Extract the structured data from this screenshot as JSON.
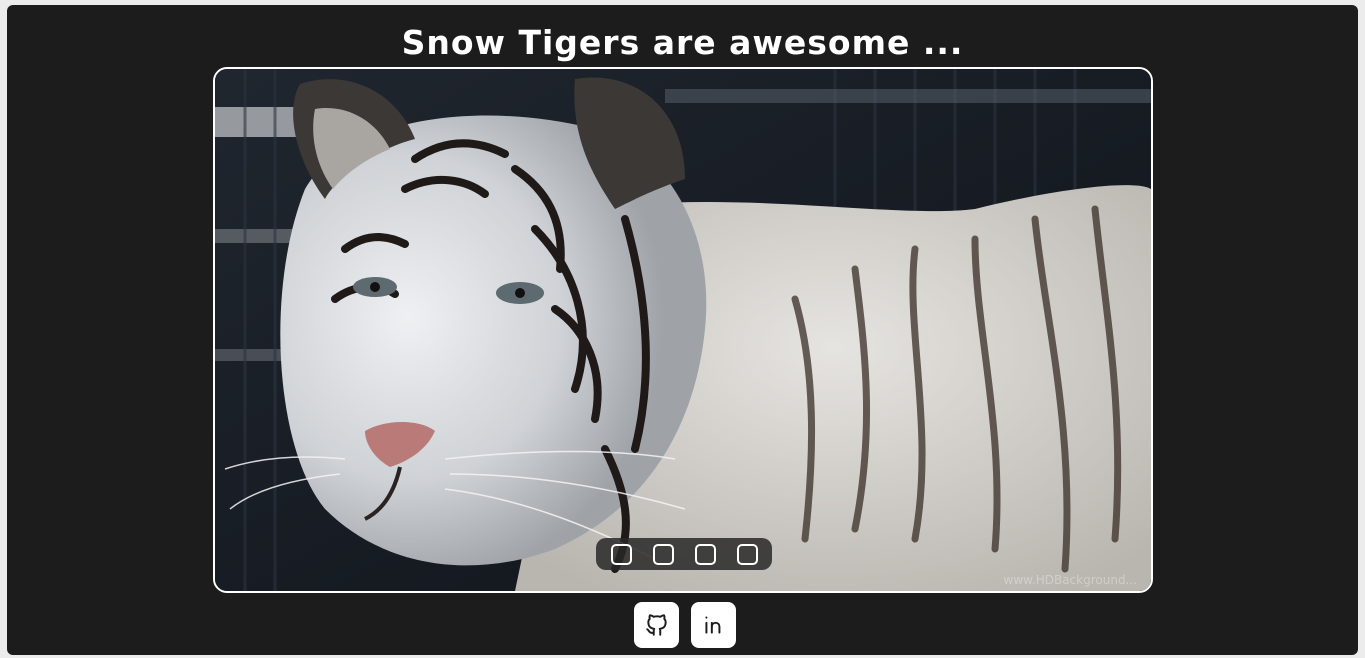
{
  "page": {
    "title": "Snow Tigers are awesome ..."
  },
  "carousel": {
    "image_alt": "White tiger",
    "watermark": "www.HDBackground...",
    "slide_count": 4,
    "active_slide": 1
  },
  "socials": [
    {
      "name": "github",
      "icon": "github-icon"
    },
    {
      "name": "linkedin",
      "icon": "linkedin-icon"
    }
  ],
  "colors": {
    "background": "#1c1c1c",
    "outer": "#ececec",
    "accent": "#ffffff"
  }
}
